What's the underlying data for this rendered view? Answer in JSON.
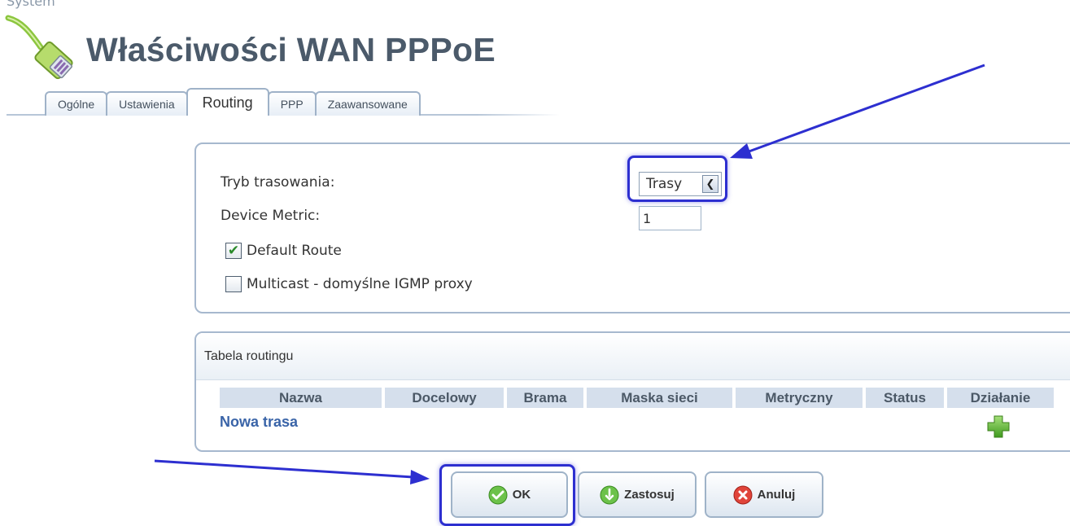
{
  "header": {
    "top_cut_text": "System",
    "title": "Właściwości WAN PPPoE"
  },
  "tabs": [
    {
      "label": "Ogólne",
      "active": false
    },
    {
      "label": "Ustawienia",
      "active": false
    },
    {
      "label": "Routing",
      "active": true
    },
    {
      "label": "PPP",
      "active": false
    },
    {
      "label": "Zaawansowane",
      "active": false
    }
  ],
  "routing": {
    "mode_label": "Tryb trasowania:",
    "mode_value": "Trasy",
    "metric_label": "Device Metric:",
    "metric_value": "1",
    "default_route_label": "Default Route",
    "default_route_checked": true,
    "multicast_label": "Multicast - domyślne IGMP proxy",
    "multicast_checked": false
  },
  "routing_table": {
    "title": "Tabela routingu",
    "columns": [
      "Nazwa",
      "Docelowy",
      "Brama",
      "Maska sieci",
      "Metryczny",
      "Status",
      "Działanie"
    ],
    "new_route_link": "Nowa trasa",
    "add_icon": "plus-icon"
  },
  "buttons": {
    "ok": "OK",
    "apply": "Zastosuj",
    "cancel": "Anuluj"
  },
  "colors": {
    "annotation": "#2d2fd0",
    "link": "#3a64a8",
    "panel_border": "#a6b8ce"
  }
}
